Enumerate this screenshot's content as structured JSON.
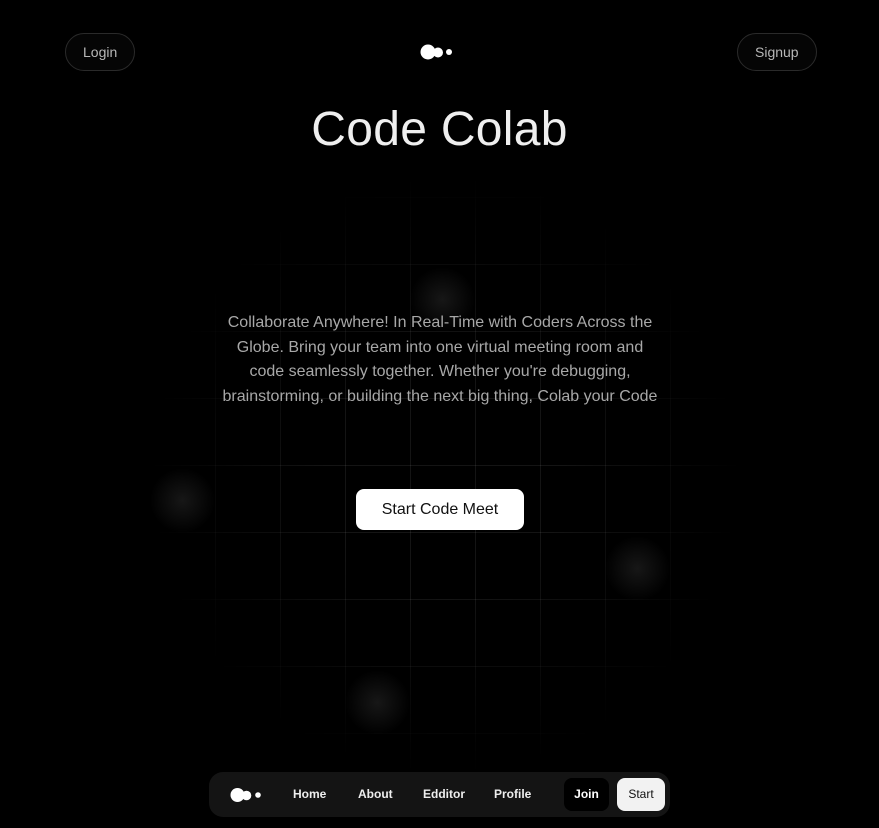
{
  "header": {
    "login_label": "Login",
    "signup_label": "Signup",
    "logo_icon": "blob-dots-logo-icon"
  },
  "hero": {
    "title": "Code Colab",
    "description": "Collaborate Anywhere! In Real-Time with Coders Across the Globe. Bring your team into one virtual meeting room and code seamlessly together. Whether you're debugging, brainstorming, or building the next big thing, Colab your Code",
    "cta_label": "Start Code Meet"
  },
  "dock": {
    "logo_icon": "blob-dots-logo-icon",
    "links": [
      "Home",
      "About",
      "Edditor",
      "Profile"
    ],
    "join_label": "Join",
    "start_label": "Start"
  },
  "colors": {
    "background": "#000000",
    "primary_button": "#ffffff",
    "dock": "#141414"
  }
}
